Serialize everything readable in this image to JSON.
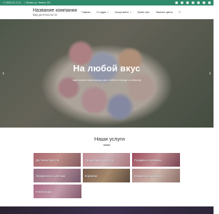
{
  "topbar": {
    "phone": "+7 (495) 111-11-11",
    "address": "г. Москва, ул. Ленина, 101",
    "socials": [
      "vk-icon",
      "ok-icon",
      "facebook-icon",
      "instagram-icon",
      "youtube-icon",
      "whatsapp-icon",
      "telegram-icon"
    ],
    "background": "#2f8a6c"
  },
  "header": {
    "company_name": "Название компании",
    "company_desc": "Вид деятельности",
    "nav": [
      {
        "label": "Главная"
      },
      {
        "label": "О студии"
      },
      {
        "label": "Ассортимент"
      },
      {
        "label": "Прайс-лист"
      },
      {
        "label": "Заказать цветы"
      }
    ]
  },
  "hero": {
    "title": "На любой вкус",
    "subtitle": "Цветочные композиции для любого повода и события"
  },
  "services": {
    "title": "Наши услуги",
    "items": [
      {
        "label": "Доставка букетов"
      },
      {
        "label": "Свадебный букет для ..."
      },
      {
        "label": "Подарки и сувениры"
      },
      {
        "label": "Оформление цветами"
      },
      {
        "label": "Корзинки"
      },
      {
        "label": "Комнатные растения"
      },
      {
        "label": "Композиции"
      }
    ]
  }
}
